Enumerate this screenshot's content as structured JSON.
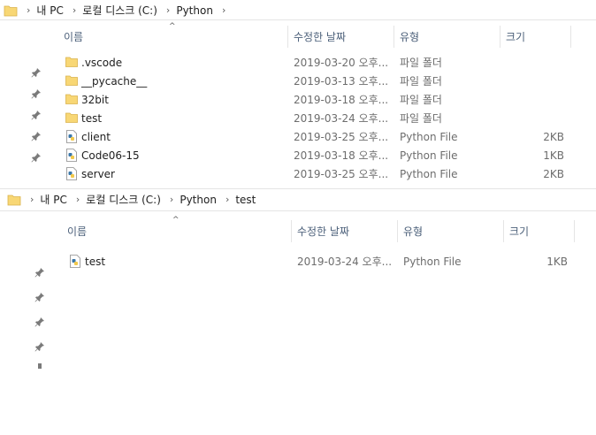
{
  "top": {
    "breadcrumb": [
      "내 PC",
      "로컬 디스크 (C:)",
      "Python"
    ],
    "columns": {
      "name": "이름",
      "date": "수정한 날짜",
      "type": "유형",
      "size": "크기"
    },
    "rows": [
      {
        "name": ".vscode",
        "date": "2019-03-20 오후...",
        "type": "파일 폴더",
        "size": "",
        "icon": "folder-icon"
      },
      {
        "name": "__pycache__",
        "date": "2019-03-13 오후...",
        "type": "파일 폴더",
        "size": "",
        "icon": "folder-icon"
      },
      {
        "name": "32bit",
        "date": "2019-03-18 오후...",
        "type": "파일 폴더",
        "size": "",
        "icon": "folder-icon"
      },
      {
        "name": "test",
        "date": "2019-03-24 오후...",
        "type": "파일 폴더",
        "size": "",
        "icon": "folder-icon"
      },
      {
        "name": "client",
        "date": "2019-03-25 오후...",
        "type": "Python File",
        "size": "2KB",
        "icon": "python-file-icon"
      },
      {
        "name": "Code06-15",
        "date": "2019-03-18 오후...",
        "type": "Python File",
        "size": "1KB",
        "icon": "python-file-icon"
      },
      {
        "name": "server",
        "date": "2019-03-25 오후...",
        "type": "Python File",
        "size": "2KB",
        "icon": "python-file-icon"
      }
    ]
  },
  "bottom": {
    "breadcrumb": [
      "내 PC",
      "로컬 디스크 (C:)",
      "Python",
      "test"
    ],
    "columns": {
      "name": "이름",
      "date": "수정한 날짜",
      "type": "유형",
      "size": "크기"
    },
    "rows": [
      {
        "name": "test",
        "date": "2019-03-24 오후...",
        "type": "Python File",
        "size": "1KB",
        "icon": "python-file-icon"
      }
    ]
  },
  "colors": {
    "header_text": "#4c607a",
    "secondary_text": "#6d6d6d",
    "folder": "#f8d775",
    "separator": "#e5e5e5"
  }
}
